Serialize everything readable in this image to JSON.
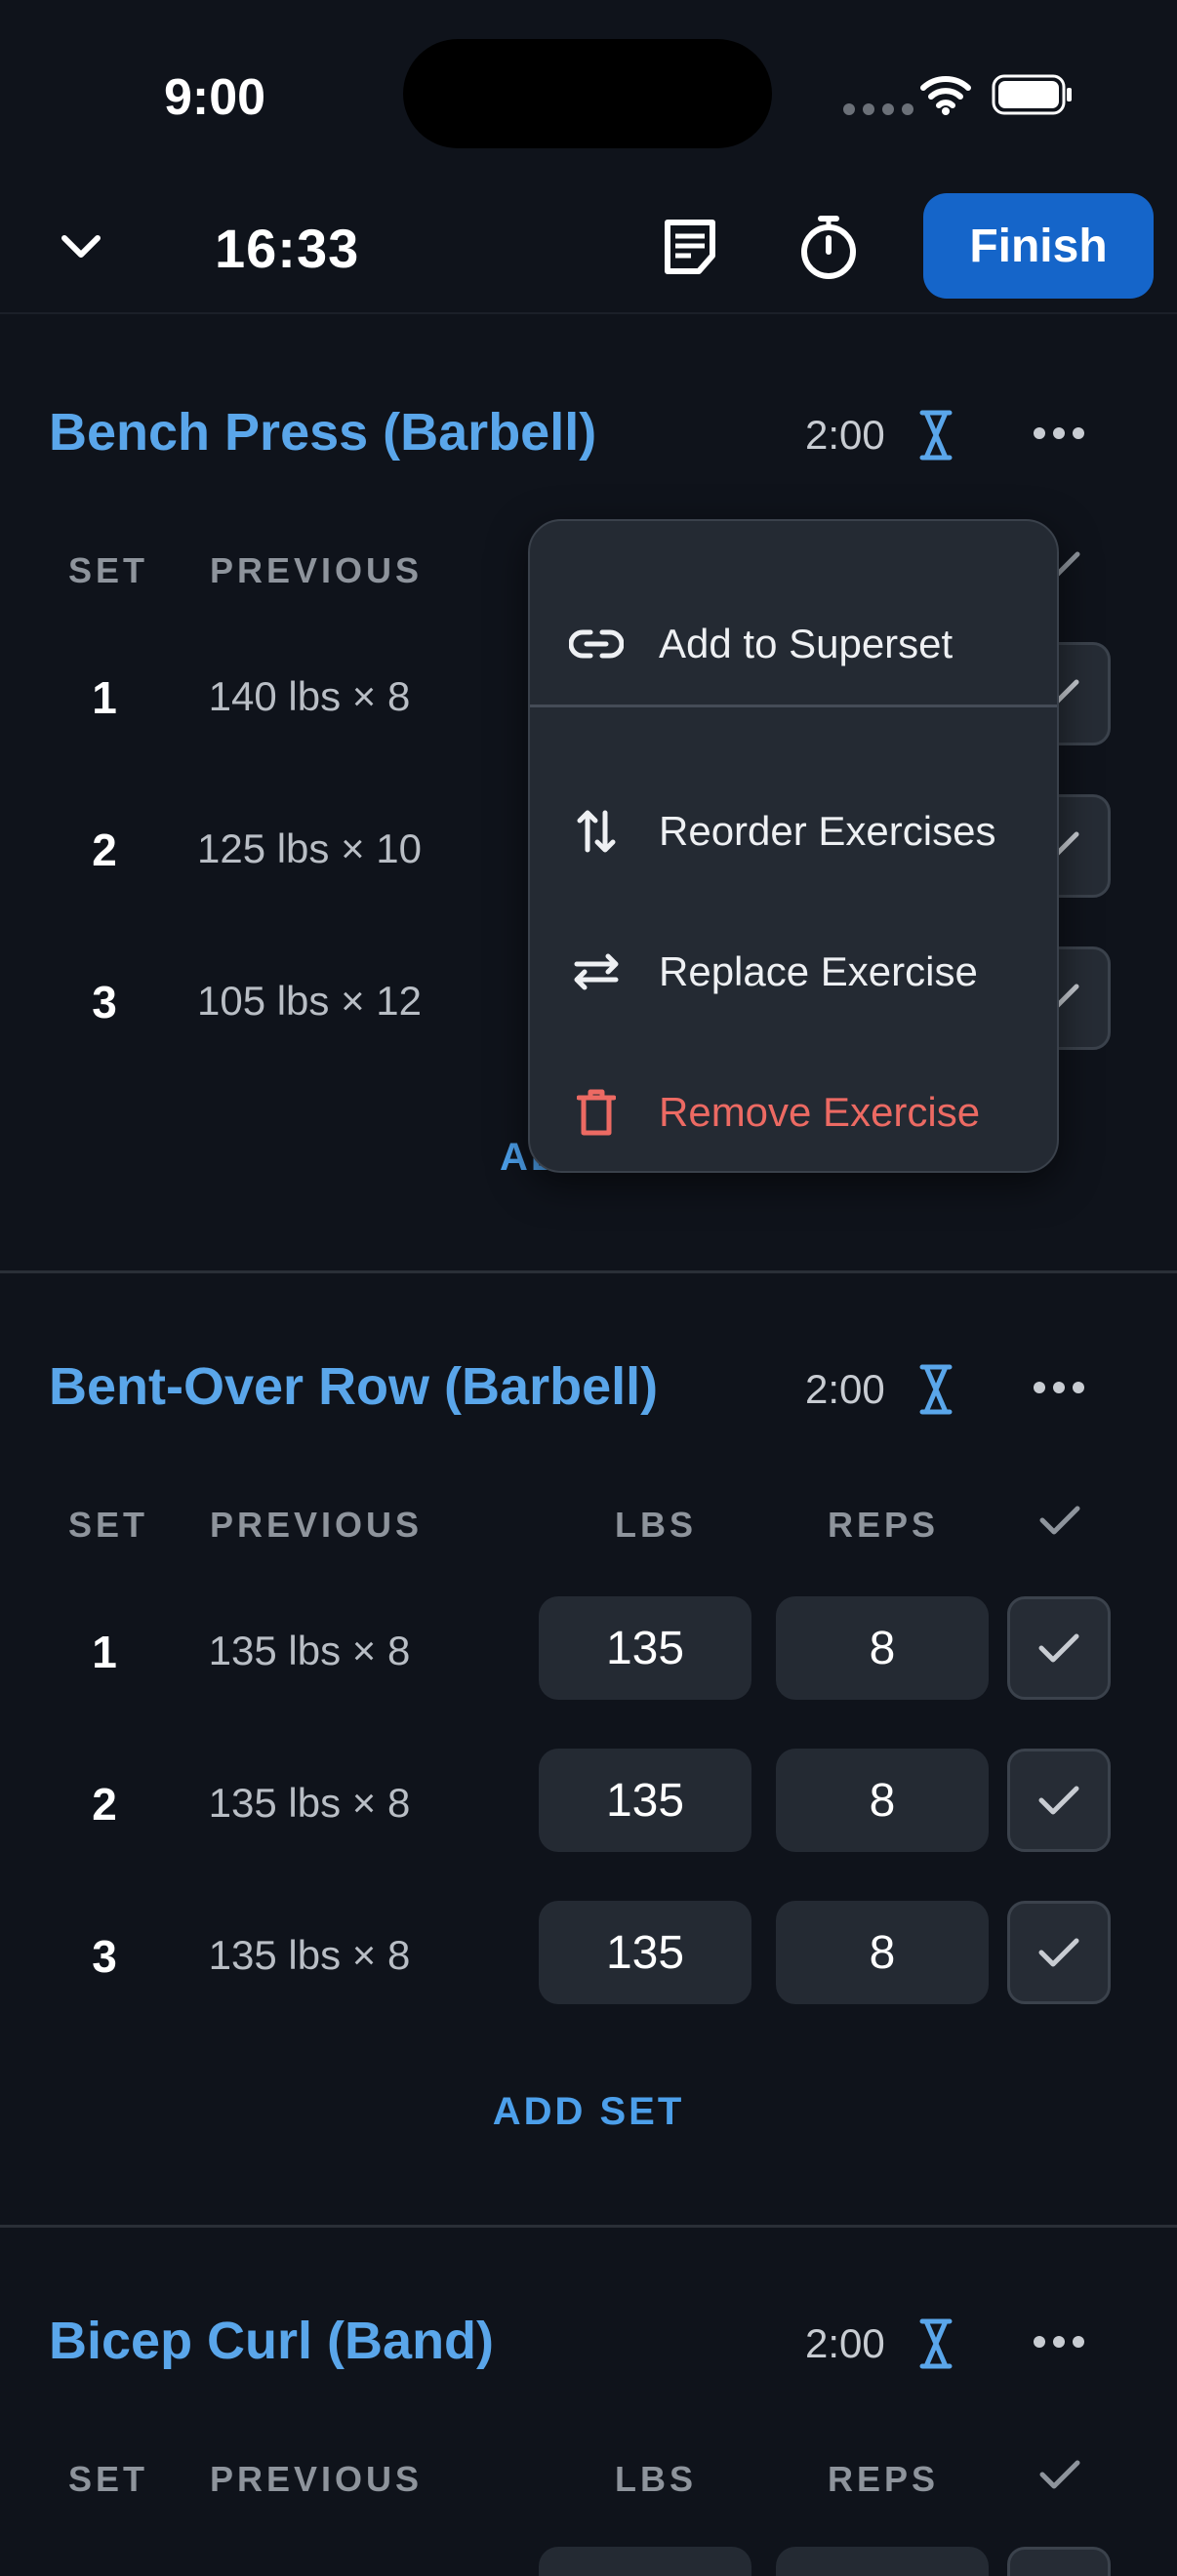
{
  "status_bar": {
    "time": "9:00"
  },
  "top_bar": {
    "timer": "16:33",
    "finish_label": "Finish"
  },
  "columns": {
    "set": "SET",
    "previous": "PREVIOUS",
    "lbs": "LBS",
    "reps": "REPS"
  },
  "exercises": [
    {
      "name": "Bench Press (Barbell)",
      "rest": "2:00",
      "sets": [
        {
          "num": "1",
          "previous": "140 lbs × 8"
        },
        {
          "num": "2",
          "previous": "125 lbs × 10"
        },
        {
          "num": "3",
          "previous": "105 lbs × 12"
        }
      ],
      "add_set_visible": "AD"
    },
    {
      "name": "Bent-Over Row (Barbell)",
      "rest": "2:00",
      "sets": [
        {
          "num": "1",
          "previous": "135 lbs × 8",
          "lbs": "135",
          "reps": "8"
        },
        {
          "num": "2",
          "previous": "135 lbs × 8",
          "lbs": "135",
          "reps": "8"
        },
        {
          "num": "3",
          "previous": "135 lbs × 8",
          "lbs": "135",
          "reps": "8"
        }
      ],
      "add_set": "ADD SET"
    },
    {
      "name": "Bicep Curl (Band)",
      "rest": "2:00"
    }
  ],
  "menu": {
    "items": [
      {
        "label": "Add to Superset",
        "icon": "link-icon"
      },
      {
        "label": "Reorder Exercises",
        "icon": "reorder-icon"
      },
      {
        "label": "Replace Exercise",
        "icon": "swap-icon"
      },
      {
        "label": "Remove Exercise",
        "icon": "trash-icon"
      }
    ]
  },
  "colors": {
    "background": "#0f131b",
    "accent": "#5aa6ea",
    "finish_button": "#1565c9",
    "danger": "#ec6a63",
    "field": "#242a33"
  }
}
